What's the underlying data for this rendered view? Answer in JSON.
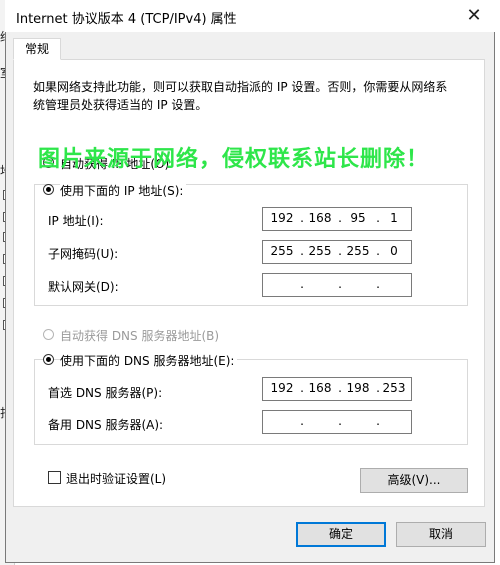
{
  "background": {
    "fragments": [
      "络",
      "室",
      "地",
      "扫"
    ]
  },
  "window": {
    "title": "Internet 协议版本 4 (TCP/IPv4) 属性",
    "close_glyph": "✕"
  },
  "tabs": [
    {
      "label": "常规"
    }
  ],
  "description": "如果网络支持此功能，则可以获取自动指派的 IP 设置。否则，你需要从网络系统管理员处获得适当的 IP 设置。",
  "watermark": "图片来源于网络，侵权联系站长删除！",
  "ip_section": {
    "auto_label": "自动获得 IP 地址(O)",
    "manual_label": "使用下面的 IP 地址(S):",
    "selected": "manual",
    "fields": [
      {
        "label": "IP 地址(I):",
        "octets": [
          "192",
          "168",
          "95",
          "1"
        ]
      },
      {
        "label": "子网掩码(U):",
        "octets": [
          "255",
          "255",
          "255",
          "0"
        ]
      },
      {
        "label": "默认网关(D):",
        "octets": [
          "",
          "",
          "",
          ""
        ]
      }
    ]
  },
  "dns_section": {
    "auto_label": "自动获得 DNS 服务器地址(B)",
    "manual_label": "使用下面的 DNS 服务器地址(E):",
    "selected": "manual",
    "fields": [
      {
        "label": "首选 DNS 服务器(P):",
        "octets": [
          "192",
          "168",
          "198",
          "253"
        ]
      },
      {
        "label": "备用 DNS 服务器(A):",
        "octets": [
          "",
          "",
          "",
          ""
        ]
      }
    ]
  },
  "validate_checkbox": {
    "label": "退出时验证设置(L)",
    "checked": false
  },
  "buttons": {
    "advanced": "高级(V)...",
    "ok": "确定",
    "cancel": "取消"
  },
  "dot": "."
}
